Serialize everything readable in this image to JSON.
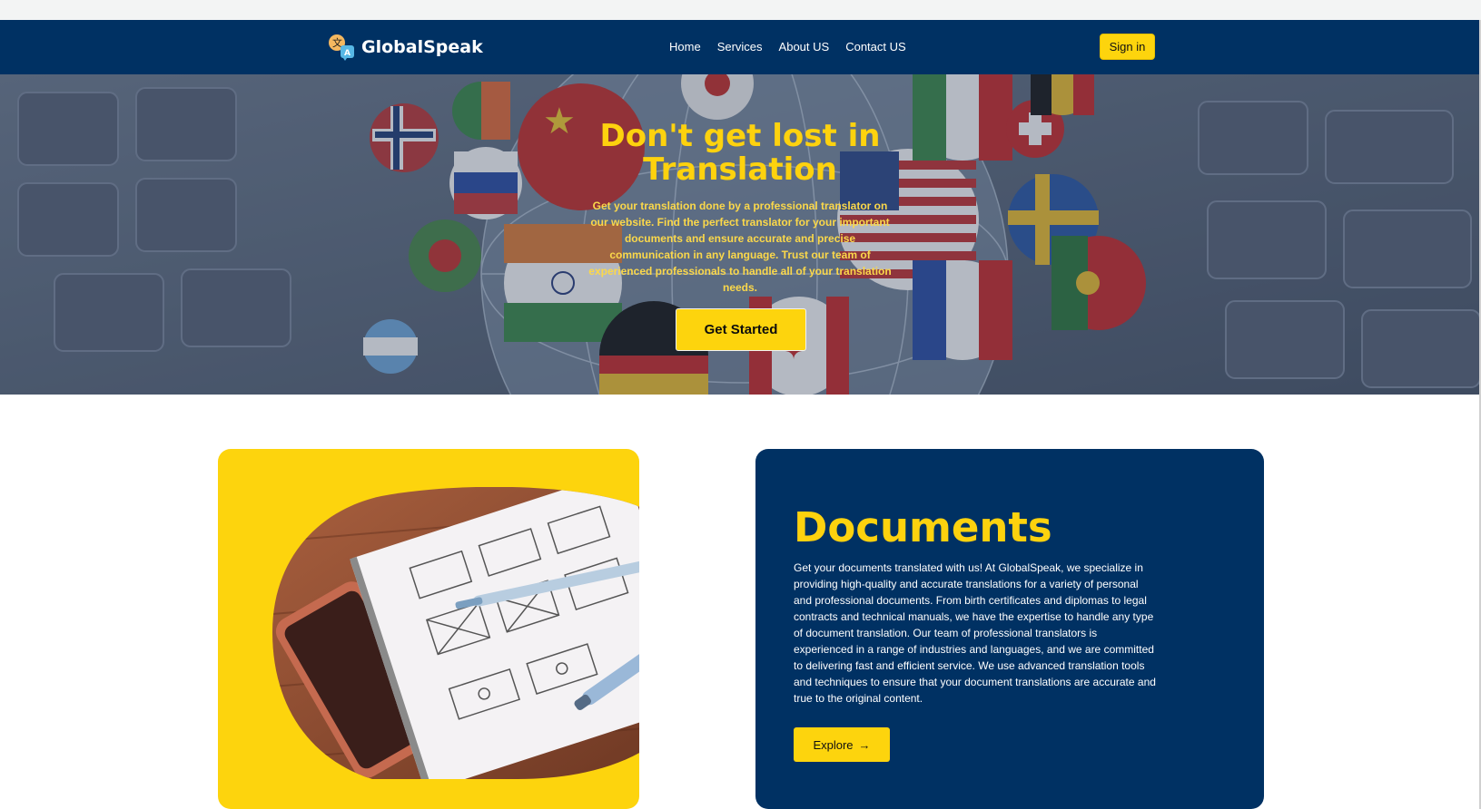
{
  "nav": {
    "brand": "GlobalSpeak",
    "links": [
      "Home",
      "Services",
      "About US",
      "Contact US"
    ],
    "signin_label": "Sign in"
  },
  "hero": {
    "title": "Don't get lost in Translation",
    "text": "Get your translation done by a professional translator on our website. Find the perfect translator for your important documents and ensure accurate and precise communication in any language. Trust our team of experienced professionals to handle all of your translation needs.",
    "button_label": "Get Started"
  },
  "documents": {
    "title": "Documents",
    "text": "Get your documents translated with us! At GlobalSpeak, we specialize in providing high-quality and accurate translations for a variety of personal and professional documents. From birth certificates and diplomas to legal contracts and technical manuals, we have the expertise to handle any type of document translation. Our team of professional translators is experienced in a range of industries and languages, and we are committed to delivering fast and efficient service. We use advanced translation tools and techniques to ensure that your document translations are accurate and true to the original content.",
    "button_label": "Explore",
    "button_icon": "→"
  },
  "colors": {
    "navy": "#003163",
    "yellow": "#fdd40d"
  }
}
